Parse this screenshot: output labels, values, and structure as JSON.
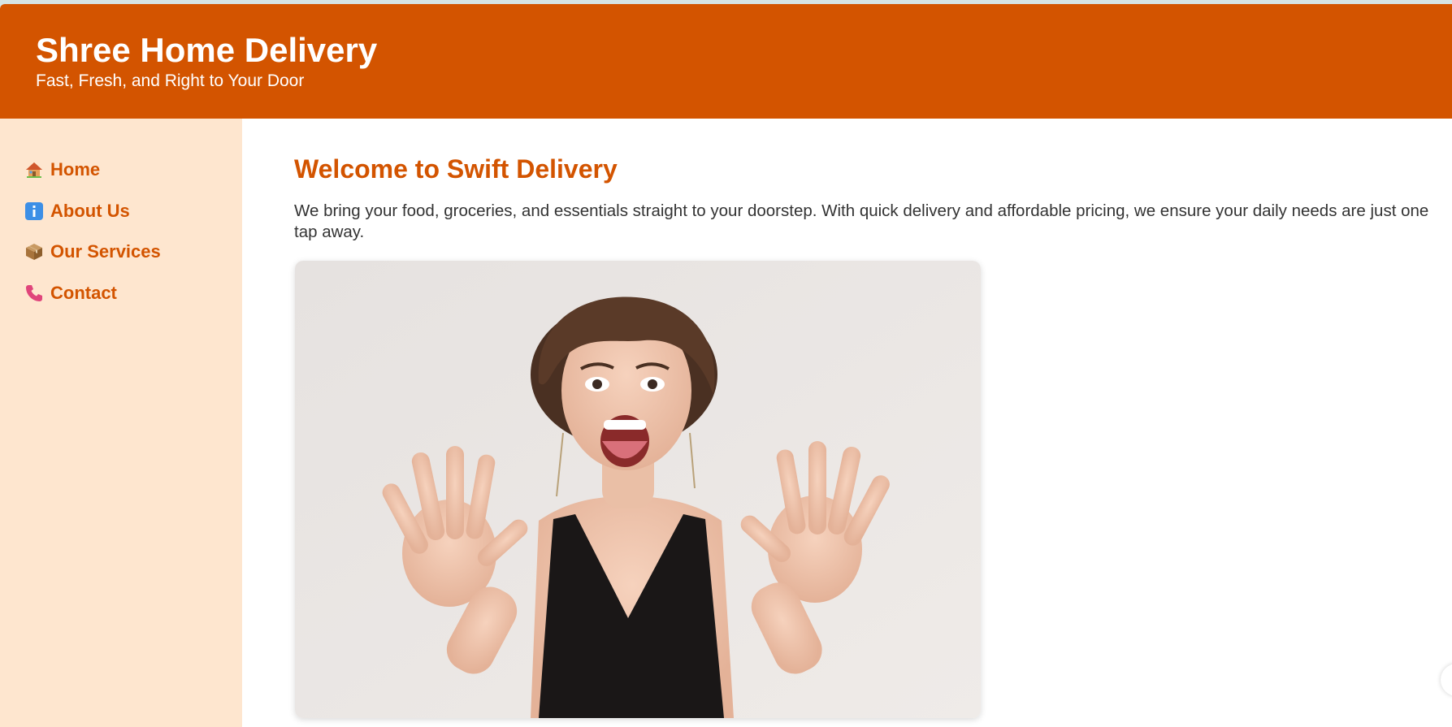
{
  "header": {
    "title": "Shree Home Delivery",
    "tagline": "Fast, Fresh, and Right to Your Door"
  },
  "sidebar": {
    "items": [
      {
        "label": "Home",
        "icon": "house-icon"
      },
      {
        "label": "About Us",
        "icon": "info-icon"
      },
      {
        "label": "Our Services",
        "icon": "package-icon"
      },
      {
        "label": "Contact",
        "icon": "phone-icon"
      }
    ]
  },
  "main": {
    "heading": "Welcome to Swift Delivery",
    "intro": "We bring your food, groceries, and essentials straight to your doorstep. With quick delivery and affordable pricing, we ensure your daily needs are just one tap away."
  },
  "colors": {
    "brand": "#d35400",
    "sidebar_bg": "#fee6cf",
    "text": "#333333"
  }
}
